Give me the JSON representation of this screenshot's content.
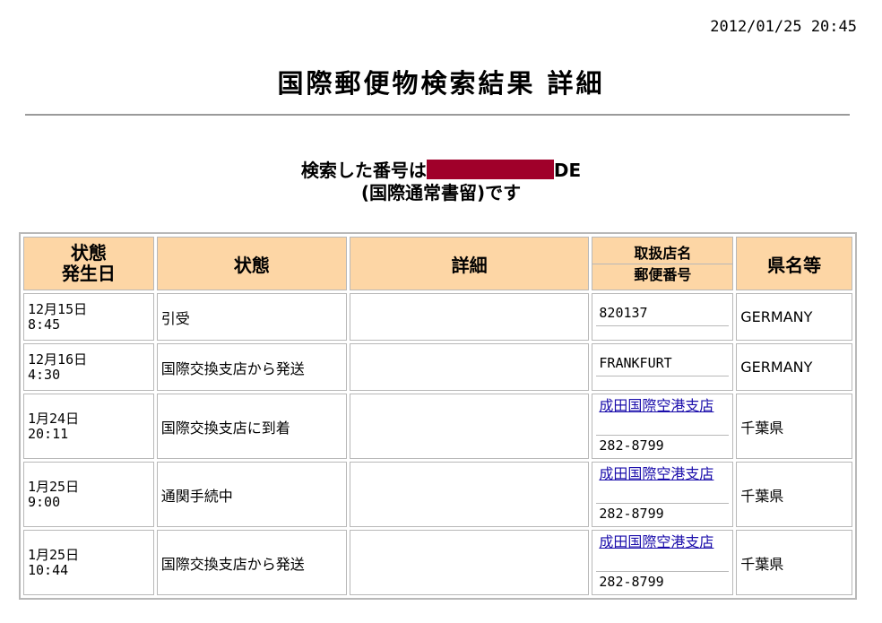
{
  "timestamp": "2012/01/25 20:45",
  "page_title": "国際郵便物検索結果 詳細",
  "search": {
    "prefix": "検索した番号は",
    "suffix": "DE",
    "type_line": "(国際通常書留)です"
  },
  "table": {
    "headers": {
      "date_line1": "状態",
      "date_line2": "発生日",
      "status": "状態",
      "detail": "詳細",
      "office_name": "取扱店名",
      "postal_code": "郵便番号",
      "prefecture": "県名等"
    },
    "rows": [
      {
        "date": "12月15日",
        "time": "8:45",
        "status": "引受",
        "detail": "",
        "office": "820137",
        "office_is_link": false,
        "postal": "",
        "prefecture": "GERMANY"
      },
      {
        "date": "12月16日",
        "time": "4:30",
        "status": "国際交換支店から発送",
        "detail": "",
        "office": "FRANKFURT",
        "office_is_link": false,
        "postal": "",
        "prefecture": "GERMANY"
      },
      {
        "date": "1月24日",
        "time": "20:11",
        "status": "国際交換支店に到着",
        "detail": "",
        "office": "成田国際空港支店",
        "office_is_link": true,
        "postal": "282-8799",
        "prefecture": "千葉県"
      },
      {
        "date": "1月25日",
        "time": "9:00",
        "status": "通関手続中",
        "detail": "",
        "office": "成田国際空港支店",
        "office_is_link": true,
        "postal": "282-8799",
        "prefecture": "千葉県"
      },
      {
        "date": "1月25日",
        "time": "10:44",
        "status": "国際交換支店から発送",
        "detail": "",
        "office": "成田国際空港支店",
        "office_is_link": true,
        "postal": "282-8799",
        "prefecture": "千葉県"
      }
    ]
  },
  "colors": {
    "header_bg": "#fdd6a5",
    "redaction": "#a0002a",
    "link": "#1a0dab",
    "border": "#b8b8b8"
  }
}
